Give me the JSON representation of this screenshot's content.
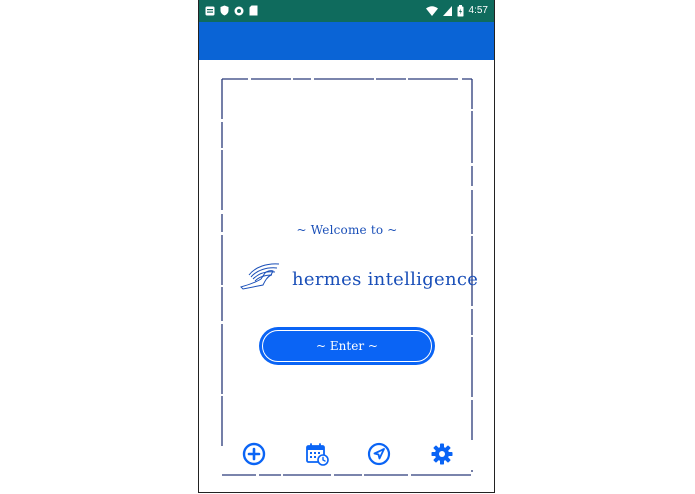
{
  "status_bar": {
    "time": "4:57",
    "icons": [
      "notification-icon",
      "shield-icon",
      "circle-icon",
      "sd-card-icon",
      "wifi-icon",
      "signal-icon",
      "battery-icon"
    ]
  },
  "main": {
    "welcome_text": "~ Welcome to ~",
    "logo_text": "hermes intelligence",
    "logo_icon": "winged-shoe-icon",
    "enter_label": "~ Enter ~"
  },
  "bottom_nav": {
    "items": [
      {
        "icon": "add-icon"
      },
      {
        "icon": "calendar-icon"
      },
      {
        "icon": "navigation-icon"
      },
      {
        "icon": "settings-icon"
      }
    ]
  },
  "colors": {
    "status_bar": "#0f6b5d",
    "app_bar": "#0a64d6",
    "accent": "#0a64f5",
    "text_blue": "#1a4fb8"
  }
}
